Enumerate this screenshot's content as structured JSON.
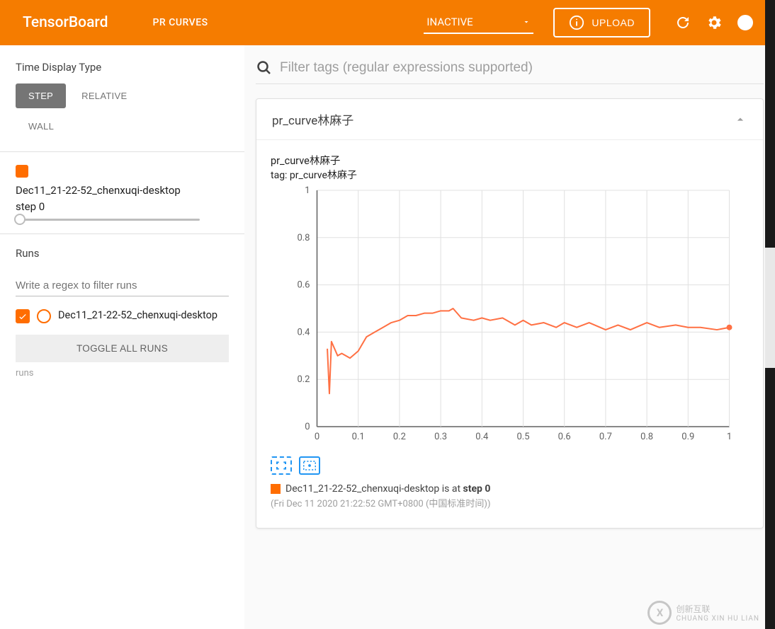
{
  "header": {
    "logo": "TensorBoard",
    "active_tab": "PR CURVES",
    "inactive_label": "INACTIVE",
    "upload_label": "UPLOAD"
  },
  "sidebar": {
    "time_display_label": "Time Display Type",
    "seg_step": "STEP",
    "seg_relative": "RELATIVE",
    "seg_wall": "WALL",
    "selected_run_name": "Dec11_21-22-52_chenxuqi-desktop",
    "step_text": "step 0",
    "runs_label": "Runs",
    "runs_filter_placeholder": "Write a regex to filter runs",
    "run_row_label": "Dec11_21-22-52_chenxuqi-desktop",
    "toggle_all_label": "TOGGLE ALL RUNS",
    "runs_footer": "runs"
  },
  "main": {
    "filter_placeholder": "Filter tags (regular expressions supported)"
  },
  "card": {
    "title": "pr_curve林麻子",
    "chart_title": "pr_curve林麻子",
    "chart_sub": "tag: pr_curve林麻子",
    "legend_prefix": "Dec11_21-22-52_chenxuqi-desktop is at ",
    "legend_bold": "step 0",
    "legend_time": "(Fri Dec 11 2020 21:22:52 GMT+0800 (中国标准时间))"
  },
  "colors": {
    "accent": "#f57c00",
    "run": "#ff6d00",
    "line": "#ff7043"
  },
  "chart_data": {
    "type": "line",
    "title": "pr_curve林麻子",
    "xlabel": "",
    "ylabel": "",
    "xlim": [
      0,
      1
    ],
    "ylim": [
      0,
      1
    ],
    "x_ticks": [
      0,
      0.1,
      0.2,
      0.3,
      0.4,
      0.5,
      0.6,
      0.7,
      0.8,
      0.9,
      1
    ],
    "y_ticks": [
      0,
      0.2,
      0.4,
      0.6,
      0.8,
      1
    ],
    "series": [
      {
        "name": "Dec11_21-22-52_chenxuqi-desktop",
        "color": "#ff7043",
        "x": [
          0.025,
          0.03,
          0.035,
          0.05,
          0.06,
          0.08,
          0.1,
          0.12,
          0.14,
          0.16,
          0.18,
          0.2,
          0.22,
          0.24,
          0.26,
          0.28,
          0.3,
          0.32,
          0.33,
          0.35,
          0.38,
          0.4,
          0.42,
          0.45,
          0.48,
          0.5,
          0.52,
          0.55,
          0.58,
          0.6,
          0.63,
          0.66,
          0.7,
          0.73,
          0.76,
          0.8,
          0.83,
          0.87,
          0.9,
          0.93,
          0.97,
          1.0
        ],
        "y": [
          0.33,
          0.14,
          0.36,
          0.3,
          0.31,
          0.29,
          0.32,
          0.38,
          0.4,
          0.42,
          0.44,
          0.45,
          0.47,
          0.47,
          0.48,
          0.48,
          0.49,
          0.49,
          0.5,
          0.46,
          0.45,
          0.46,
          0.45,
          0.46,
          0.43,
          0.45,
          0.43,
          0.44,
          0.42,
          0.44,
          0.42,
          0.44,
          0.41,
          0.43,
          0.41,
          0.44,
          0.42,
          0.43,
          0.42,
          0.42,
          0.41,
          0.42
        ],
        "end_marker": [
          1.0,
          0.42
        ]
      }
    ]
  },
  "watermark": {
    "text": "创新互联",
    "sub": "CHUANG XIN HU LIAN"
  }
}
